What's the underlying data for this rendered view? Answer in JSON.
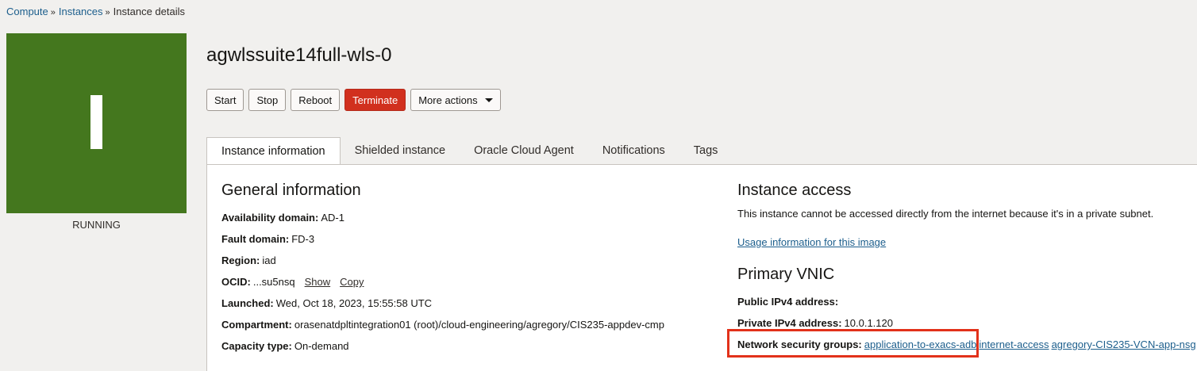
{
  "breadcrumb": {
    "compute": "Compute",
    "instances": "Instances",
    "current": "Instance details",
    "separator": "»"
  },
  "instance": {
    "name": "agwlssuite14full-wls-0",
    "state": "RUNNING",
    "state_color": "#44771e"
  },
  "actions": {
    "start": "Start",
    "stop": "Stop",
    "reboot": "Reboot",
    "terminate": "Terminate",
    "more": "More actions"
  },
  "tabs": [
    {
      "label": "Instance information",
      "active": true
    },
    {
      "label": "Shielded instance"
    },
    {
      "label": "Oracle Cloud Agent"
    },
    {
      "label": "Notifications"
    },
    {
      "label": "Tags"
    }
  ],
  "general": {
    "title": "General information",
    "availability_domain": {
      "label": "Availability domain:",
      "value": "AD-1"
    },
    "fault_domain": {
      "label": "Fault domain:",
      "value": "FD-3"
    },
    "region": {
      "label": "Region:",
      "value": "iad"
    },
    "ocid": {
      "label": "OCID:",
      "value": "...su5nsq",
      "show": "Show",
      "copy": "Copy"
    },
    "launched": {
      "label": "Launched:",
      "value": "Wed, Oct 18, 2023, 15:55:58 UTC"
    },
    "compartment": {
      "label": "Compartment:",
      "value": "orasenatdpltintegration01 (root)/cloud-engineering/agregory/CIS235-appdev-cmp"
    },
    "capacity_type": {
      "label": "Capacity type:",
      "value": "On-demand"
    }
  },
  "access": {
    "title": "Instance access",
    "description": "This instance cannot be accessed directly from the internet because it's in a private subnet.",
    "usage_link": "Usage information for this image"
  },
  "vnic": {
    "title": "Primary VNIC",
    "public_ipv4": {
      "label": "Public IPv4 address:",
      "value": ""
    },
    "private_ipv4": {
      "label": "Private IPv4 address:",
      "value": "10.0.1.120"
    },
    "nsg": {
      "label": "Network security groups:",
      "groups": [
        "application-to-exacs-adb",
        "internet-access",
        "agregory-CIS235-VCN-app-nsg"
      ]
    }
  },
  "colors": {
    "accent_red": "#d1301e",
    "link_blue": "#1c5e8c",
    "highlight": "#e2311a"
  }
}
